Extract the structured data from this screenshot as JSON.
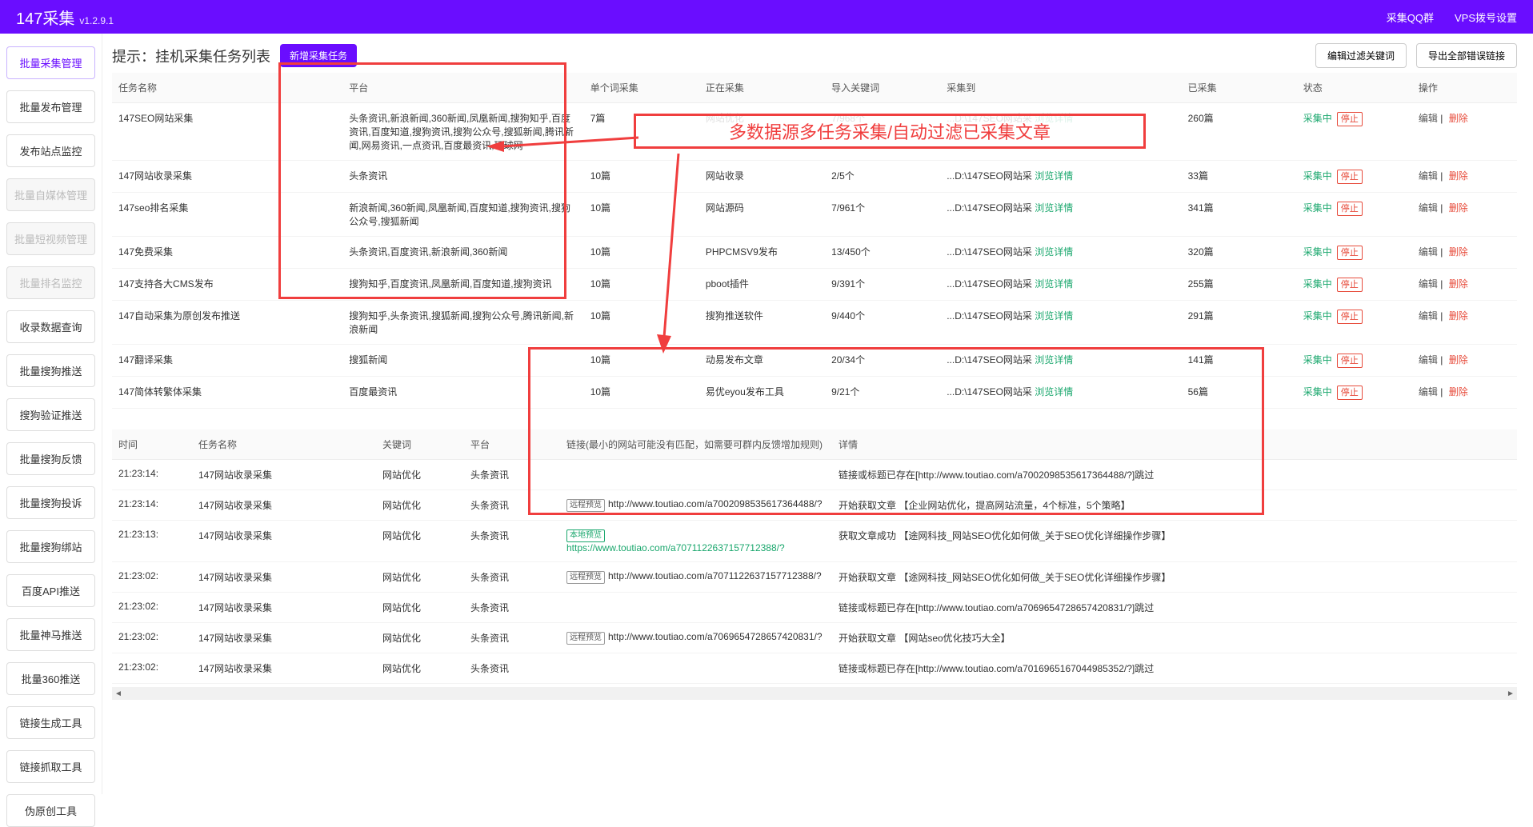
{
  "header": {
    "title": "147采集",
    "version": "v1.2.9.1",
    "qq_group": "采集QQ群",
    "vps_dial": "VPS拨号设置"
  },
  "sidebar": {
    "items": [
      {
        "label": "批量采集管理",
        "state": "active"
      },
      {
        "label": "批量发布管理",
        "state": "normal"
      },
      {
        "label": "发布站点监控",
        "state": "normal"
      },
      {
        "label": "批量自媒体管理",
        "state": "disabled"
      },
      {
        "label": "批量短视频管理",
        "state": "disabled"
      },
      {
        "label": "批量排名监控",
        "state": "disabled"
      },
      {
        "label": "收录数据查询",
        "state": "normal"
      },
      {
        "label": "批量搜狗推送",
        "state": "normal"
      },
      {
        "label": "搜狗验证推送",
        "state": "normal"
      },
      {
        "label": "批量搜狗反馈",
        "state": "normal"
      },
      {
        "label": "批量搜狗投诉",
        "state": "normal"
      },
      {
        "label": "批量搜狗绑站",
        "state": "normal"
      },
      {
        "label": "百度API推送",
        "state": "normal"
      },
      {
        "label": "批量神马推送",
        "state": "normal"
      },
      {
        "label": "批量360推送",
        "state": "normal"
      },
      {
        "label": "链接生成工具",
        "state": "normal"
      },
      {
        "label": "链接抓取工具",
        "state": "normal"
      },
      {
        "label": "伪原创工具",
        "state": "normal"
      }
    ]
  },
  "page": {
    "title": "提示：挂机采集任务列表",
    "new_task": "新增采集任务",
    "edit_filter": "编辑过滤关键词",
    "export_errors": "导出全部错误链接"
  },
  "task_table": {
    "cols": {
      "name": "任务名称",
      "platform": "平台",
      "single": "单个词采集",
      "collecting": "正在采集",
      "import_kw": "导入关键词",
      "collect_to": "采集到",
      "collected": "已采集",
      "status": "状态",
      "op": "操作"
    },
    "view_detail": "浏览详情",
    "status_running": "采集中",
    "stop": "停止",
    "edit": "编辑",
    "sep": " | ",
    "del": "删除",
    "rows": [
      {
        "name": "147SEO网站采集",
        "platform": "头条资讯,新浪新闻,360新闻,凤凰新闻,搜狗知乎,百度资讯,百度知道,搜狗资讯,搜狗公众号,搜狐新闻,腾讯新闻,网易资讯,一点资讯,百度最资讯,环球网",
        "single": "7篇",
        "collecting": "网站优化",
        "import_kw": "7/968个",
        "collect_to": "...D:\\147SEO网站采",
        "collected": "260篇"
      },
      {
        "name": "147网站收录采集",
        "platform": "头条资讯",
        "single": "10篇",
        "collecting": "网站收录",
        "import_kw": "2/5个",
        "collect_to": "...D:\\147SEO网站采",
        "collected": "33篇"
      },
      {
        "name": "147seo排名采集",
        "platform": "新浪新闻,360新闻,凤凰新闻,百度知道,搜狗资讯,搜狗公众号,搜狐新闻",
        "single": "10篇",
        "collecting": "网站源码",
        "import_kw": "7/961个",
        "collect_to": "...D:\\147SEO网站采",
        "collected": "341篇"
      },
      {
        "name": "147免费采集",
        "platform": "头条资讯,百度资讯,新浪新闻,360新闻",
        "single": "10篇",
        "collecting": "PHPCMSV9发布",
        "import_kw": "13/450个",
        "collect_to": "...D:\\147SEO网站采",
        "collected": "320篇"
      },
      {
        "name": "147支持各大CMS发布",
        "platform": "搜狗知乎,百度资讯,凤凰新闻,百度知道,搜狗资讯",
        "single": "10篇",
        "collecting": "pboot插件",
        "import_kw": "9/391个",
        "collect_to": "...D:\\147SEO网站采",
        "collected": "255篇"
      },
      {
        "name": "147自动采集为原创发布推送",
        "platform": "搜狗知乎,头条资讯,搜狐新闻,搜狗公众号,腾讯新闻,新浪新闻",
        "single": "10篇",
        "collecting": "搜狗推送软件",
        "import_kw": "9/440个",
        "collect_to": "...D:\\147SEO网站采",
        "collected": "291篇"
      },
      {
        "name": "147翻译采集",
        "platform": "搜狐新闻",
        "single": "10篇",
        "collecting": "动易发布文章",
        "import_kw": "20/34个",
        "collect_to": "...D:\\147SEO网站采",
        "collected": "141篇"
      },
      {
        "name": "147简体转繁体采集",
        "platform": "百度最资讯",
        "single": "10篇",
        "collecting": "易优eyou发布工具",
        "import_kw": "9/21个",
        "collect_to": "...D:\\147SEO网站采",
        "collected": "56篇"
      }
    ]
  },
  "log_table": {
    "cols": {
      "time": "时间",
      "task": "任务名称",
      "keyword": "关键词",
      "platform": "平台",
      "link": "链接(最小的网站可能没有匹配，如需要可群内反馈增加规则)",
      "detail": "详情"
    },
    "tag_remote": "远程预览",
    "tag_local": "本地预览",
    "rows": [
      {
        "time": "21:23:14:",
        "task": "147网站收录采集",
        "keyword": "网站优化",
        "platform": "头条资讯",
        "link_type": "",
        "link": "",
        "detail": "链接或标题已存在[http://www.toutiao.com/a7002098535617364488/?]跳过"
      },
      {
        "time": "21:23:14:",
        "task": "147网站收录采集",
        "keyword": "网站优化",
        "platform": "头条资讯",
        "link_type": "remote",
        "link": "http://www.toutiao.com/a7002098535617364488/?",
        "detail": "开始获取文章 【企业网站优化，提高网站流量，4个标准，5个策略】"
      },
      {
        "time": "21:23:13:",
        "task": "147网站收录采集",
        "keyword": "网站优化",
        "platform": "头条资讯",
        "link_type": "local",
        "link": "https://www.toutiao.com/a7071122637157712388/?",
        "detail": "获取文章成功 【途网科技_网站SEO优化如何做_关于SEO优化详细操作步骤】"
      },
      {
        "time": "21:23:02:",
        "task": "147网站收录采集",
        "keyword": "网站优化",
        "platform": "头条资讯",
        "link_type": "remote",
        "link": "http://www.toutiao.com/a7071122637157712388/?",
        "detail": "开始获取文章 【途网科技_网站SEO优化如何做_关于SEO优化详细操作步骤】"
      },
      {
        "time": "21:23:02:",
        "task": "147网站收录采集",
        "keyword": "网站优化",
        "platform": "头条资讯",
        "link_type": "",
        "link": "",
        "detail": "链接或标题已存在[http://www.toutiao.com/a7069654728657420831/?]跳过"
      },
      {
        "time": "21:23:02:",
        "task": "147网站收录采集",
        "keyword": "网站优化",
        "platform": "头条资讯",
        "link_type": "remote",
        "link": "http://www.toutiao.com/a7069654728657420831/?",
        "detail": "开始获取文章 【网站seo优化技巧大全】"
      },
      {
        "time": "21:23:02:",
        "task": "147网站收录采集",
        "keyword": "网站优化",
        "platform": "头条资讯",
        "link_type": "",
        "link": "",
        "detail": "链接或标题已存在[http://www.toutiao.com/a7016965167044985352/?]跳过"
      }
    ]
  },
  "annotation": {
    "callout": "多数据源多任务采集/自动过滤已采集文章"
  }
}
